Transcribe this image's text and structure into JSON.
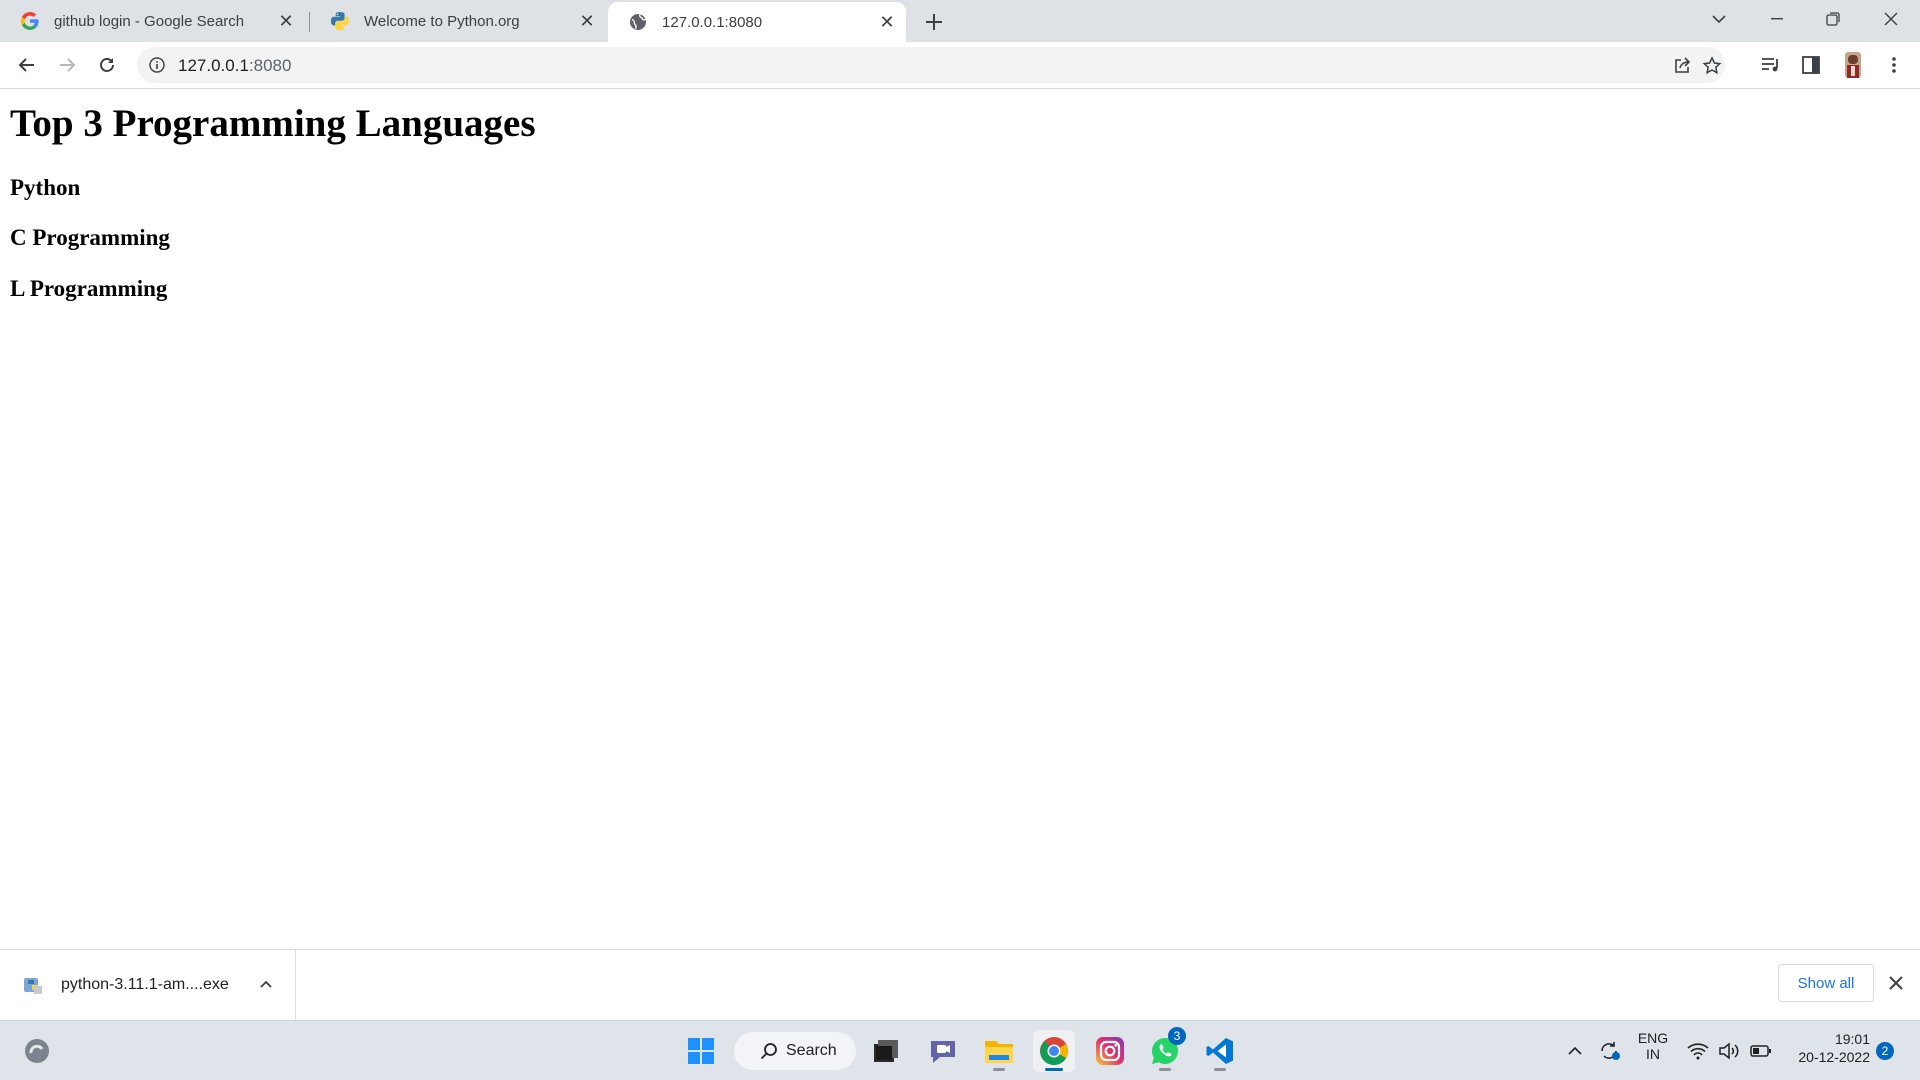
{
  "browser": {
    "tabs": [
      {
        "title": "github login - Google Search",
        "favicon": "google-g-icon",
        "active": false
      },
      {
        "title": "Welcome to Python.org",
        "favicon": "python-logo-icon",
        "active": false
      },
      {
        "title": "127.0.0.1:8080",
        "favicon": "globe-icon",
        "active": true
      }
    ],
    "address_bar": {
      "host": "127.0.0.1",
      "port": ":8080"
    }
  },
  "page": {
    "heading": "Top 3 Programming Languages",
    "items": [
      "Python",
      "C Programming",
      "L Programming"
    ]
  },
  "download_shelf": {
    "file_name": "python-3.11.1-am....exe",
    "show_all_label": "Show all"
  },
  "taskbar": {
    "search_label": "Search",
    "whatsapp_badge": "3",
    "language_line1": "ENG",
    "language_line2": "IN",
    "time": "19:01",
    "date": "20-12-2022",
    "notification_count": "2"
  },
  "colors": {
    "tabstrip_bg": "#dee1e6",
    "accent_blue": "#1a73e8",
    "taskbar_bg": "#dfe3ea"
  }
}
